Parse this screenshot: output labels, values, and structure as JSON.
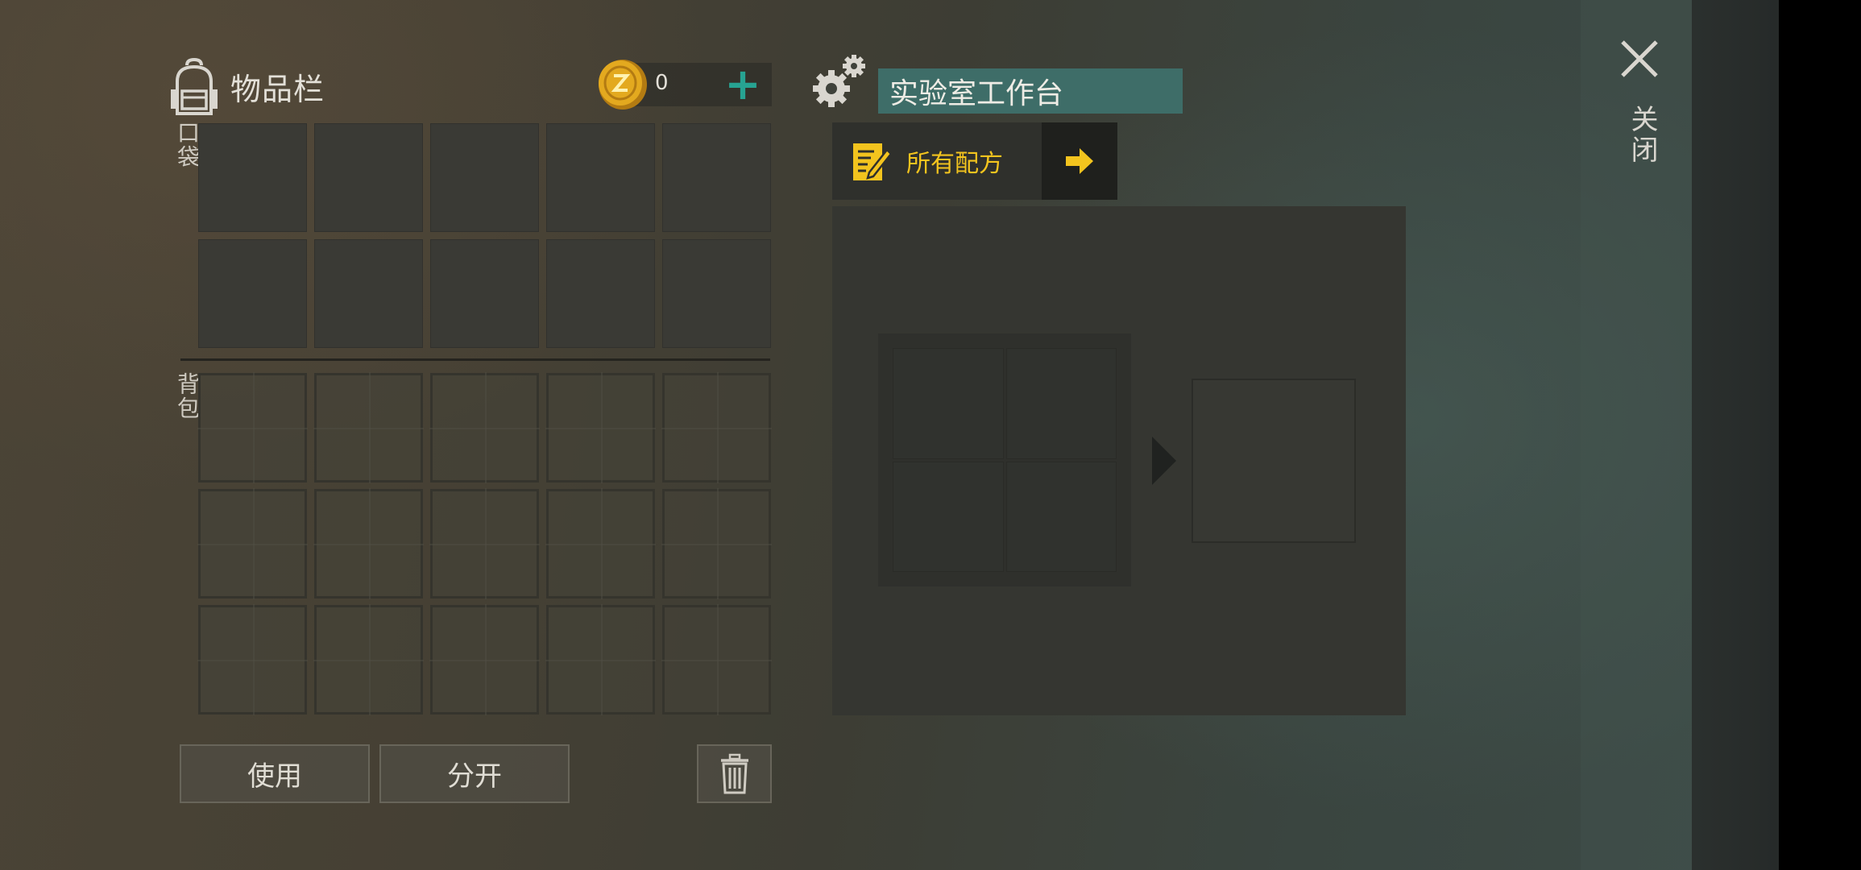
{
  "inventory": {
    "title": "物品栏",
    "coins": {
      "count": "0",
      "add_symbol": "+"
    },
    "pocket_label": "口袋",
    "bag_label": "背包",
    "use_label": "使用",
    "split_label": "分开"
  },
  "workbench": {
    "title": "实验室工作台",
    "recipes_label": "所有配方"
  },
  "close_label": "关闭",
  "colors": {
    "accent_teal": "#27a392",
    "title_bar": "#3e6d68",
    "recipe_yellow": "#f3c41e",
    "coin_gold": "#e3a91f"
  },
  "icons": [
    "backpack-icon",
    "coin-icon",
    "plus-icon",
    "gear-icon",
    "recipe-icon",
    "arrow-right-icon",
    "trash-icon",
    "close-icon"
  ]
}
